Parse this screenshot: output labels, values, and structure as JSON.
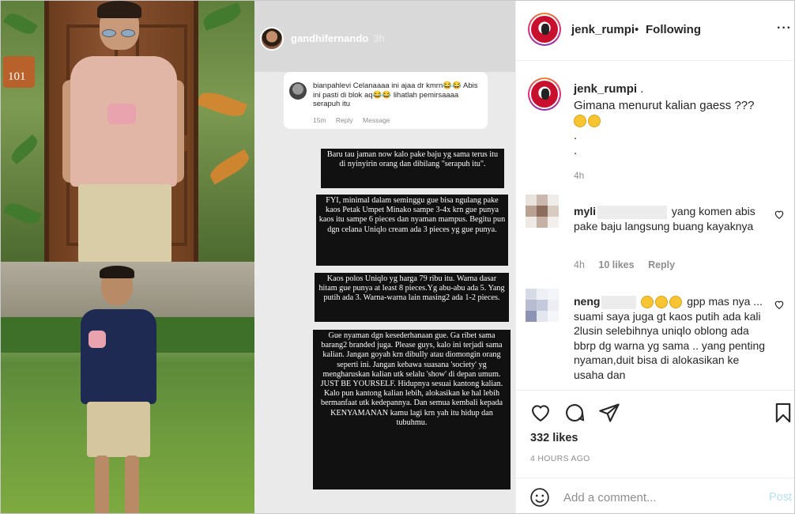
{
  "photos": {
    "door_number": "101"
  },
  "story": {
    "username": "gandhifernando",
    "time": "3h",
    "reply": {
      "username": "bianpahlevi",
      "text": " Celanaaaa ini ajaa dr kmrn😂😂 Abis ini pasti di blok aq😂😂 lihatlah pemirsaaaa serapuh itu",
      "time": "15m",
      "reply_label": "Reply",
      "message_label": "Message"
    },
    "boxes": [
      "Baru tau jaman now kalo pake baju yg sama terus itu di nyinyirin orang dan dibilang \"serapuh itu\".",
      "FYI, minimal dalam seminggu gue bisa ngulang pake kaos Petak Umpet Minako sampe 3-4x krn gue punya kaos itu sampe 6 pieces dan nyaman mampus. Begitu pun dgn celana Uniqlo cream ada 3 pieces yg gue punya.",
      "Kaos polos Uniqlo yg harga 79 ribu itu. Warna dasar hitam gue punya at least 8 pieces.Yg abu-abu ada 5. Yang putih ada 3. Warna-warna lain masing2 ada 1-2 pieces.",
      "Gue nyaman dgn kesederhanaan gue. Ga ribet sama barang2 branded juga. Please guys, kalo ini terjadi sama kalian. Jangan goyah krn dibully atau diomongin orang seperti ini. Jangan kebawa suasana 'society' yg mengharuskan kalian utk selalu 'show' di depan umum. JUST BE YOURSELF. Hidupnya sesuai kantong kalian. Kalo pun kantong kalian lebih, alokasikan ke hal lebih bermanfaat utk kedepannya. Dan semua kembali kepada KENYAMANAN kamu lagi krn yah itu hidup dan tubuhmu."
    ]
  },
  "panel": {
    "header": {
      "username": "jenk_rumpi",
      "separator": "•",
      "follow_status": "Following",
      "more_icon": "more-horizontal-icon"
    },
    "caption": {
      "username": "jenk_rumpi",
      "username_suffix": " .",
      "line1": "Gimana menurut kalian gaess ???",
      "line2": ".",
      "line3": ".",
      "time": "4h"
    },
    "comments": [
      {
        "username": "myli",
        "text": "yang komen abis pake baju langsung buang kayaknya",
        "time": "4h",
        "likes": "10 likes",
        "reply_label": "Reply",
        "avatar_colors": [
          "#e9e3df",
          "#cbb8ac",
          "#f0ece9",
          "#b9a193",
          "#8c6d5c",
          "#d8cbc2",
          "#efe9e5",
          "#c6b2a5",
          "#f3efec"
        ]
      },
      {
        "username": "neng",
        "text": "gpp mas nya ... suami saya juga gt kaos putih ada kali 2lusin selebihnya uniqlo oblong ada bbrp dg warna yg sama .. yang penting nyaman,duit bisa di alokasikan ke usaha dan",
        "avatar_colors": [
          "#d7dbe6",
          "#eef0f5",
          "#f4f5f8",
          "#b7bcd0",
          "#c4c9db",
          "#eceef3",
          "#8d93b5",
          "#e3e6ee",
          "#f5f6f9"
        ]
      }
    ],
    "actions": {
      "likes": "332 likes",
      "time": "4 HOURS AGO"
    },
    "add_comment": {
      "placeholder": "Add a comment...",
      "post_label": "Post"
    }
  }
}
